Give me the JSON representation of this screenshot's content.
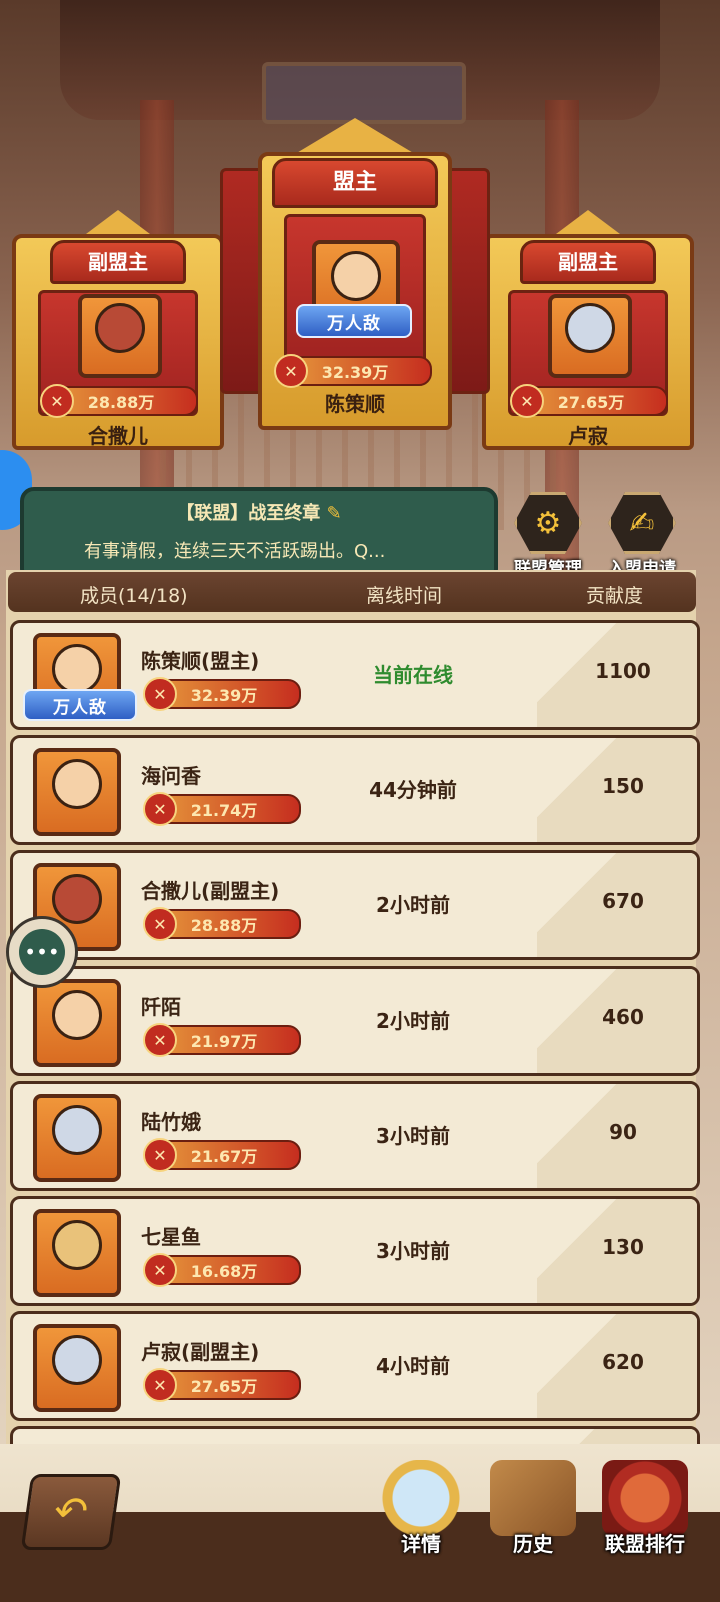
{
  "leaders": {
    "leader": {
      "title": "盟主",
      "name": "陈策顺",
      "power": "32.39万",
      "badge": "万人敌"
    },
    "deputy_left": {
      "title": "副盟主",
      "name": "合撒儿",
      "power": "28.88万"
    },
    "deputy_right": {
      "title": "副盟主",
      "name": "卢寂",
      "power": "27.65万"
    }
  },
  "announcement": {
    "title": "【联盟】战至终章",
    "text": "有事请假，连续三天不活跃踢出。Q..."
  },
  "actions": {
    "manage_label": "联盟管理",
    "apply_label": "入盟申请"
  },
  "table": {
    "headers": {
      "member": "成员(14/18)",
      "offline": "离线时间",
      "contribution": "贡献度"
    },
    "rows": [
      {
        "name": "陈策顺(盟主)",
        "power": "32.39万",
        "time": "当前在线",
        "contribution": "1100",
        "badge": "万人敌"
      },
      {
        "name": "海问香",
        "power": "21.74万",
        "time": "44分钟前",
        "contribution": "150"
      },
      {
        "name": "合撒儿(副盟主)",
        "power": "28.88万",
        "time": "2小时前",
        "contribution": "670"
      },
      {
        "name": "阡陌",
        "power": "21.97万",
        "time": "2小时前",
        "contribution": "460"
      },
      {
        "name": "陆竹娥",
        "power": "21.67万",
        "time": "3小时前",
        "contribution": "90"
      },
      {
        "name": "七星鱼",
        "power": "16.68万",
        "time": "3小时前",
        "contribution": "130"
      },
      {
        "name": "卢寂(副盟主)",
        "power": "27.65万",
        "time": "4小时前",
        "contribution": "620"
      }
    ]
  },
  "bottom_nav": {
    "details_label": "详情",
    "history_label": "历史",
    "ranking_label": "联盟排行"
  },
  "icons": {
    "power": "crossed-swords-icon",
    "edit": "pencil-icon",
    "manage": "gear-icon",
    "apply": "document-pen-icon",
    "back": "back-arrow-icon",
    "chat": "chat-bubble-icon"
  },
  "colors": {
    "online": "#2e8b2e",
    "panel": "#2f5c4c",
    "header": "#54331f"
  }
}
